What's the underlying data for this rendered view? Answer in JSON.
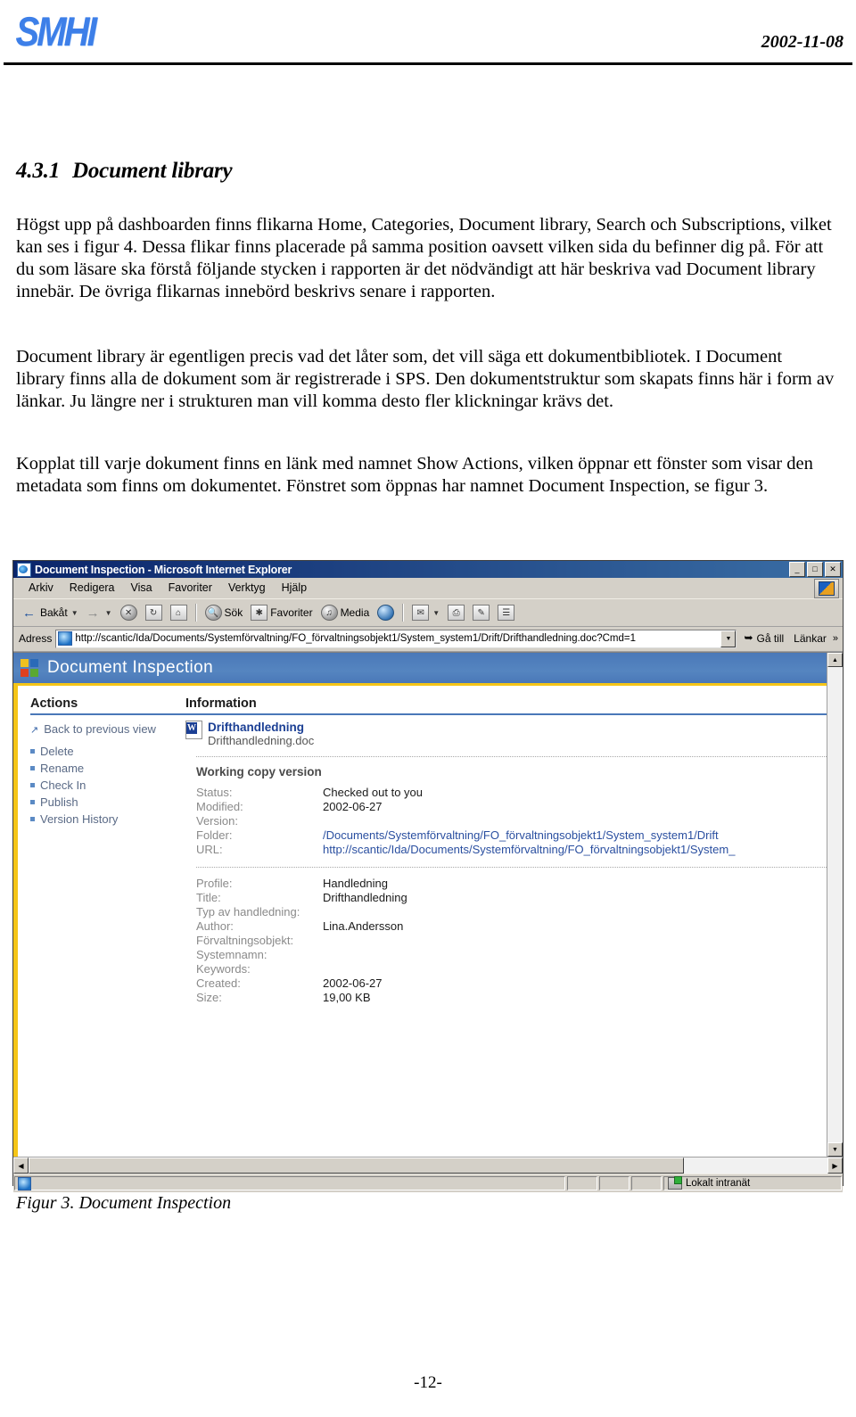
{
  "header": {
    "logo_text": "SMHI",
    "date": "2002-11-08"
  },
  "section": {
    "number": "4.3.1",
    "title": "Document library"
  },
  "paragraphs": {
    "p1": "Högst upp på dashboarden finns flikarna Home, Categories, Document library, Search och Subscriptions, vilket kan ses i figur 4. Dessa flikar finns placerade på samma position oavsett vilken sida du befinner dig på. För att du som läsare ska förstå följande stycken i rapporten är det nödvändigt att här beskriva vad Document library innebär. De övriga flikarnas innebörd beskrivs senare i rapporten.",
    "p2": "Document library är egentligen precis vad det låter som, det vill säga ett dokumentbibliotek. I Document library finns alla de dokument som är registrerade i SPS. Den dokumentstruktur som skapats finns här i form av länkar. Ju längre ner i strukturen man vill komma desto fler klickningar krävs det.",
    "p3": "Kopplat till varje dokument finns en länk med namnet Show Actions, vilken öppnar ett fönster som visar den metadata som finns om dokumentet. Fönstret som öppnas har namnet Document Inspection, se figur 3."
  },
  "figure": {
    "caption_prefix": "Figur 3.",
    "caption_text": "Document Inspection"
  },
  "page_number": "-12-",
  "browser": {
    "title": "Document Inspection - Microsoft Internet Explorer",
    "window_buttons": {
      "minimize": "_",
      "maximize": "□",
      "close": "✕"
    },
    "menu": [
      "Arkiv",
      "Redigera",
      "Visa",
      "Favoriter",
      "Verktyg",
      "Hjälp"
    ],
    "toolbar": {
      "back": "Bakåt",
      "search": "Sök",
      "favorites": "Favoriter",
      "media": "Media"
    },
    "address": {
      "label": "Adress",
      "url": "http://scantic/Ida/Documents/Systemförvaltning/FO_förvaltningsobjekt1/System_system1/Drift/Drifthandledning.doc?Cmd=1",
      "go_label": "Gå till",
      "links_label": "Länkar"
    },
    "status": {
      "zone": "Lokalt intranät"
    }
  },
  "app": {
    "title": "Document Inspection",
    "logo_colors": [
      "#f0c020",
      "#2a6ab8",
      "#e04020",
      "#5aa832"
    ],
    "accent_yellow": "#f5c518",
    "accent_blue": "#4a78b8",
    "actions": {
      "heading": "Actions",
      "back_link": "Back to previous view",
      "items": [
        "Delete",
        "Rename",
        "Check In",
        "Publish",
        "Version History"
      ]
    },
    "information": {
      "heading": "Information",
      "doc_title": "Drifthandledning",
      "doc_filename": "Drifthandledning.doc",
      "working_copy_label": "Working copy version",
      "fields_top": [
        {
          "key": "Status:",
          "value": "Checked out to you",
          "is_link": false
        },
        {
          "key": "Modified:",
          "value": "2002-06-27",
          "is_link": false
        },
        {
          "key": "Version:",
          "value": "",
          "is_link": false
        },
        {
          "key": "Folder:",
          "value": "/Documents/Systemförvaltning/FO_förvaltningsobjekt1/System_system1/Drift",
          "is_link": true
        },
        {
          "key": "URL:",
          "value": "http://scantic/Ida/Documents/Systemförvaltning/FO_förvaltningsobjekt1/System_",
          "is_link": true
        }
      ],
      "fields_bottom": [
        {
          "key": "Profile:",
          "value": "Handledning"
        },
        {
          "key": "Title:",
          "value": "Drifthandledning"
        },
        {
          "key": "Typ av handledning:",
          "value": ""
        },
        {
          "key": "Author:",
          "value": "Lina.Andersson"
        },
        {
          "key": "Förvaltningsobjekt:",
          "value": ""
        },
        {
          "key": "Systemnamn:",
          "value": ""
        },
        {
          "key": "Keywords:",
          "value": ""
        },
        {
          "key": "Created:",
          "value": "2002-06-27"
        },
        {
          "key": "Size:",
          "value": "19,00 KB"
        }
      ]
    }
  }
}
